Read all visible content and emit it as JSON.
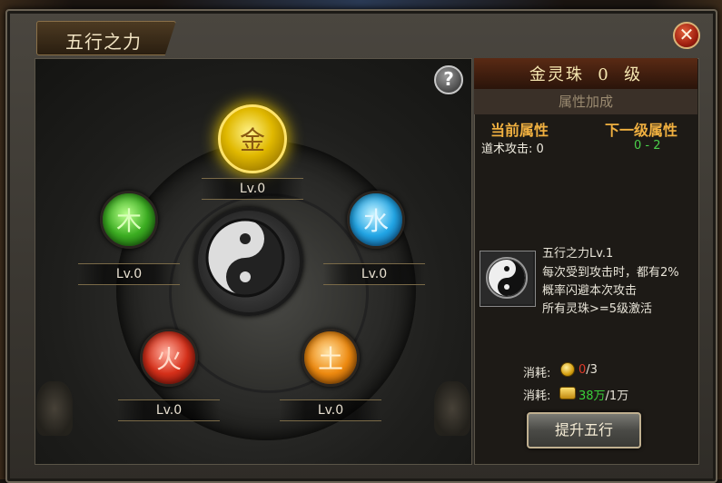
{
  "window": {
    "title": "五行之力"
  },
  "header": {
    "close_glyph": "✕",
    "help_glyph": "?"
  },
  "orbs": {
    "gold": {
      "glyph": "金",
      "level": "Lv.0"
    },
    "wood": {
      "glyph": "木",
      "level": "Lv.0"
    },
    "water": {
      "glyph": "水",
      "level": "Lv.0"
    },
    "fire": {
      "glyph": "火",
      "level": "Lv.0"
    },
    "earth": {
      "glyph": "土",
      "level": "Lv.0"
    }
  },
  "detail": {
    "title": "金灵珠  0  级",
    "section_header": "属性加成",
    "current_header": "当前属性",
    "next_header": "下一级属性",
    "current_stat": "道术攻击: 0",
    "next_stat": "0 - 2"
  },
  "skill": {
    "icon": "yin-yang",
    "name": "五行之力Lv.1",
    "line1": "每次受到攻击时，都有2%",
    "line2": "概率闪避本次攻击",
    "line3": "所有灵珠>=5级激活"
  },
  "costs": [
    {
      "label": "消耗:",
      "icon": "coin",
      "have": "0",
      "need": "/3",
      "have_color": "#e03a2a"
    },
    {
      "label": "消耗:",
      "icon": "gold-ingots",
      "have": "38万",
      "need": "/1万",
      "have_color": "#3ad03a"
    }
  ],
  "actions": {
    "upgrade_label": "提升五行"
  },
  "colors": {
    "accent": "#f0b040",
    "gold_orb": "#e0b800",
    "green_value": "#4ad04a"
  }
}
